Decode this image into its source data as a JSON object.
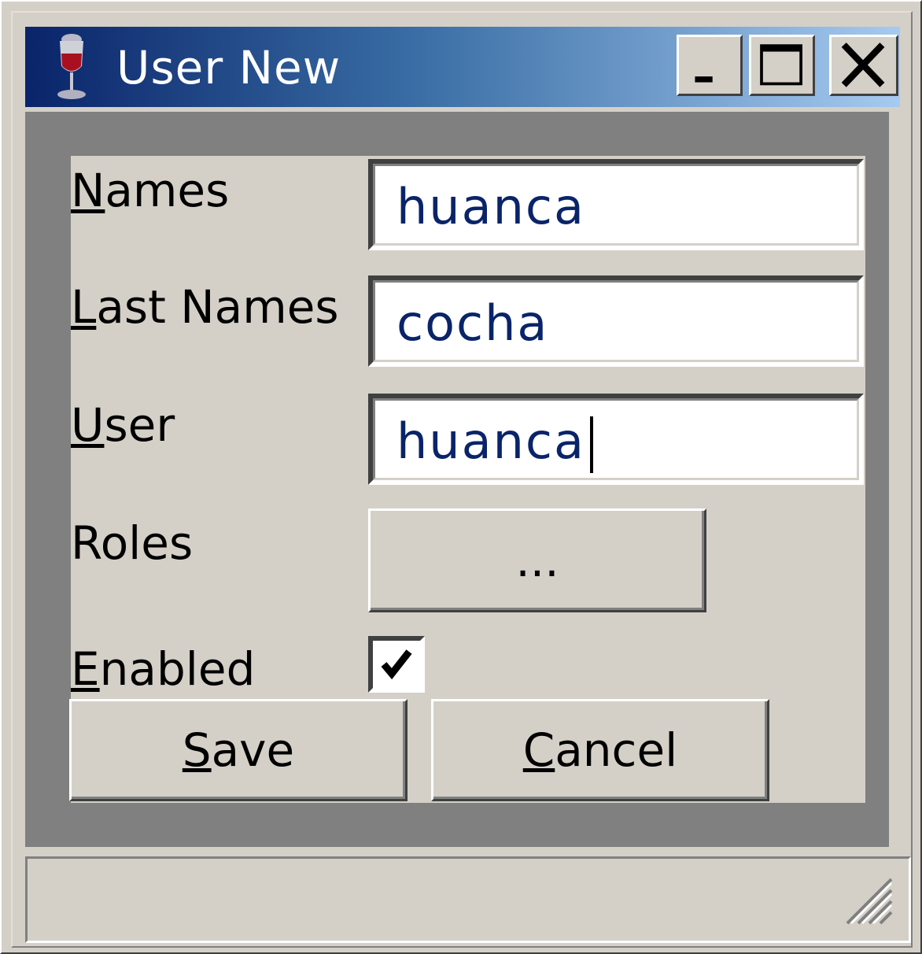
{
  "window": {
    "title": "User New",
    "icon": "wine-glass-icon"
  },
  "title_buttons": {
    "minimize_icon": "minimize-icon",
    "maximize_icon": "maximize-icon",
    "close_icon": "close-icon"
  },
  "form": {
    "names": {
      "mnemonic": "N",
      "rest": "ames",
      "value": "huanca"
    },
    "last_names": {
      "mnemonic": "L",
      "rest": "ast Names",
      "value": "cocha"
    },
    "user": {
      "mnemonic": "U",
      "rest": "ser",
      "value": "huanca"
    },
    "roles": {
      "label": "Roles",
      "button_label": "..."
    },
    "enabled": {
      "mnemonic": "E",
      "rest": "nabled",
      "checked": true
    }
  },
  "actions": {
    "save": {
      "mnemonic": "S",
      "rest": "ave"
    },
    "cancel": {
      "mnemonic": "C",
      "rest": "ancel"
    }
  },
  "statusbar": {
    "text": ""
  },
  "colors": {
    "titlebar_start": "#0a246a",
    "titlebar_end": "#a6caf0",
    "face": "#d4d0c8",
    "content_bg": "#808080",
    "field_text": "#0a246a"
  }
}
